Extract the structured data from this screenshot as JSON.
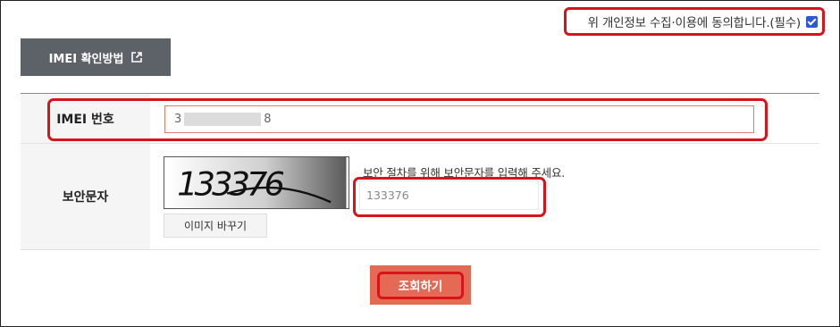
{
  "consent": {
    "label": "위 개인정보 수집·이용에 동의합니다.(필수)",
    "checked": true
  },
  "guide_button": {
    "label": "IMEI 확인방법",
    "icon": "external-link-icon"
  },
  "form": {
    "imei": {
      "label": "IMEI 번호",
      "value_start": "3",
      "value_end": "8"
    },
    "captcha": {
      "label": "보안문자",
      "image_text": "133376",
      "refresh_label": "이미지 바꾸기",
      "help_text": "보안 절차를 위해 보안문자를 입력해 주세요.",
      "input_value": "133376"
    }
  },
  "submit": {
    "label": "조회하기"
  },
  "colors": {
    "highlight": "#d7141a",
    "submit_bg": "#e56a56",
    "guide_bg": "#5d6268",
    "checkbox": "#2c59d6"
  }
}
